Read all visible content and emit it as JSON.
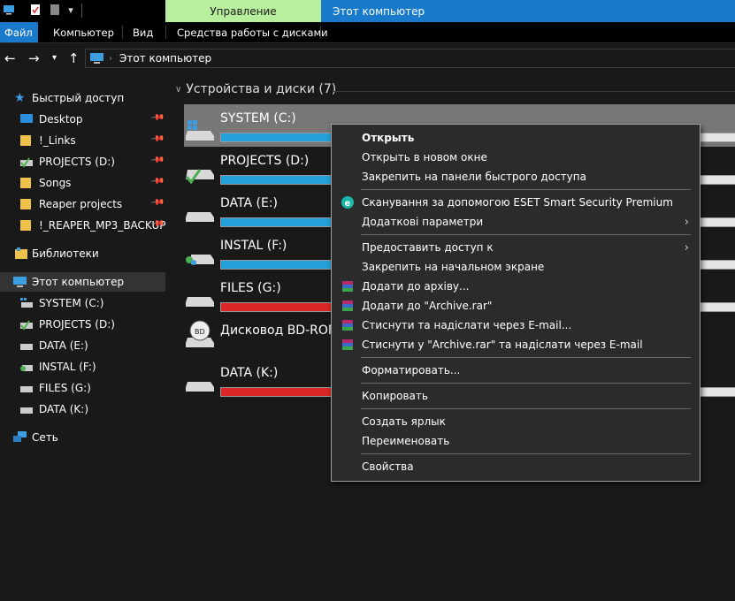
{
  "window": {
    "context_tab_label": "Управление",
    "title": "Этот компьютер",
    "ribbon_tabs": [
      "Файл",
      "Компьютер",
      "Вид",
      "Средства работы с дисками"
    ]
  },
  "address_bar": {
    "path": "Этот компьютер"
  },
  "sidebar": {
    "quick_access": "Быстрый доступ",
    "quick_items": [
      "Desktop",
      "!_Links",
      "PROJECTS (D:)",
      "Songs",
      "Reaper projects",
      "!_REAPER_MP3_BACKUP"
    ],
    "libraries": "Библиотеки",
    "this_pc": "Этот компьютер",
    "pc_items": [
      "SYSTEM (C:)",
      "PROJECTS (D:)",
      "DATA (E:)",
      "INSTAL (F:)",
      "FILES (G:)",
      "DATA (K:)"
    ],
    "network": "Сеть"
  },
  "main": {
    "group_header": "Устройства и диски (7)",
    "drives": [
      {
        "label": "SYSTEM (C:)",
        "fill": 0.28,
        "color": "#26a0da",
        "icon": "windows-drive-icon"
      },
      {
        "label": "PROJECTS (D:)",
        "fill": 0.28,
        "color": "#26a0da",
        "icon": "drive-check-icon"
      },
      {
        "label": "DATA (E:)",
        "fill": 0.28,
        "color": "#26a0da",
        "icon": "drive-icon"
      },
      {
        "label": "INSTAL (F:)",
        "fill": 0.28,
        "color": "#26a0da",
        "icon": "drive-users-icon"
      },
      {
        "label": "FILES (G:)",
        "fill": 0.28,
        "color": "#da2626",
        "icon": "drive-icon"
      },
      {
        "label": "Дисковод BD-ROM",
        "fill": null,
        "color": null,
        "icon": "bd-rom-icon"
      },
      {
        "label": "DATA (K:)",
        "fill": 0.28,
        "color": "#da2626",
        "icon": "drive-icon"
      }
    ]
  },
  "context_menu": {
    "open": "Открыть",
    "open_new_window": "Открыть в новом окне",
    "pin_quick_access": "Закрепить на панели быстрого доступа",
    "eset_scan": "Сканування за допомогою ESET Smart Security Premium",
    "more_params": "Додаткові параметри",
    "share": "Предоставить доступ к",
    "pin_start": "Закрепить на начальном экране",
    "add_archive": "Додати до архіву...",
    "add_archive_rar": "Додати до \"Archive.rar\"",
    "compress_email": "Стиснути та надіслати через E-mail...",
    "compress_rar_email": "Стиснути у \"Archive.rar\" та надіслати через E-mail",
    "format": "Форматировать...",
    "copy": "Копировать",
    "create_shortcut": "Создать ярлык",
    "rename": "Переименовать",
    "properties": "Свойства"
  },
  "colors": {
    "accent": "#1979ca",
    "context_tab": "#b8ef9f",
    "bar_blue": "#26a0da",
    "bar_red": "#da2626"
  }
}
